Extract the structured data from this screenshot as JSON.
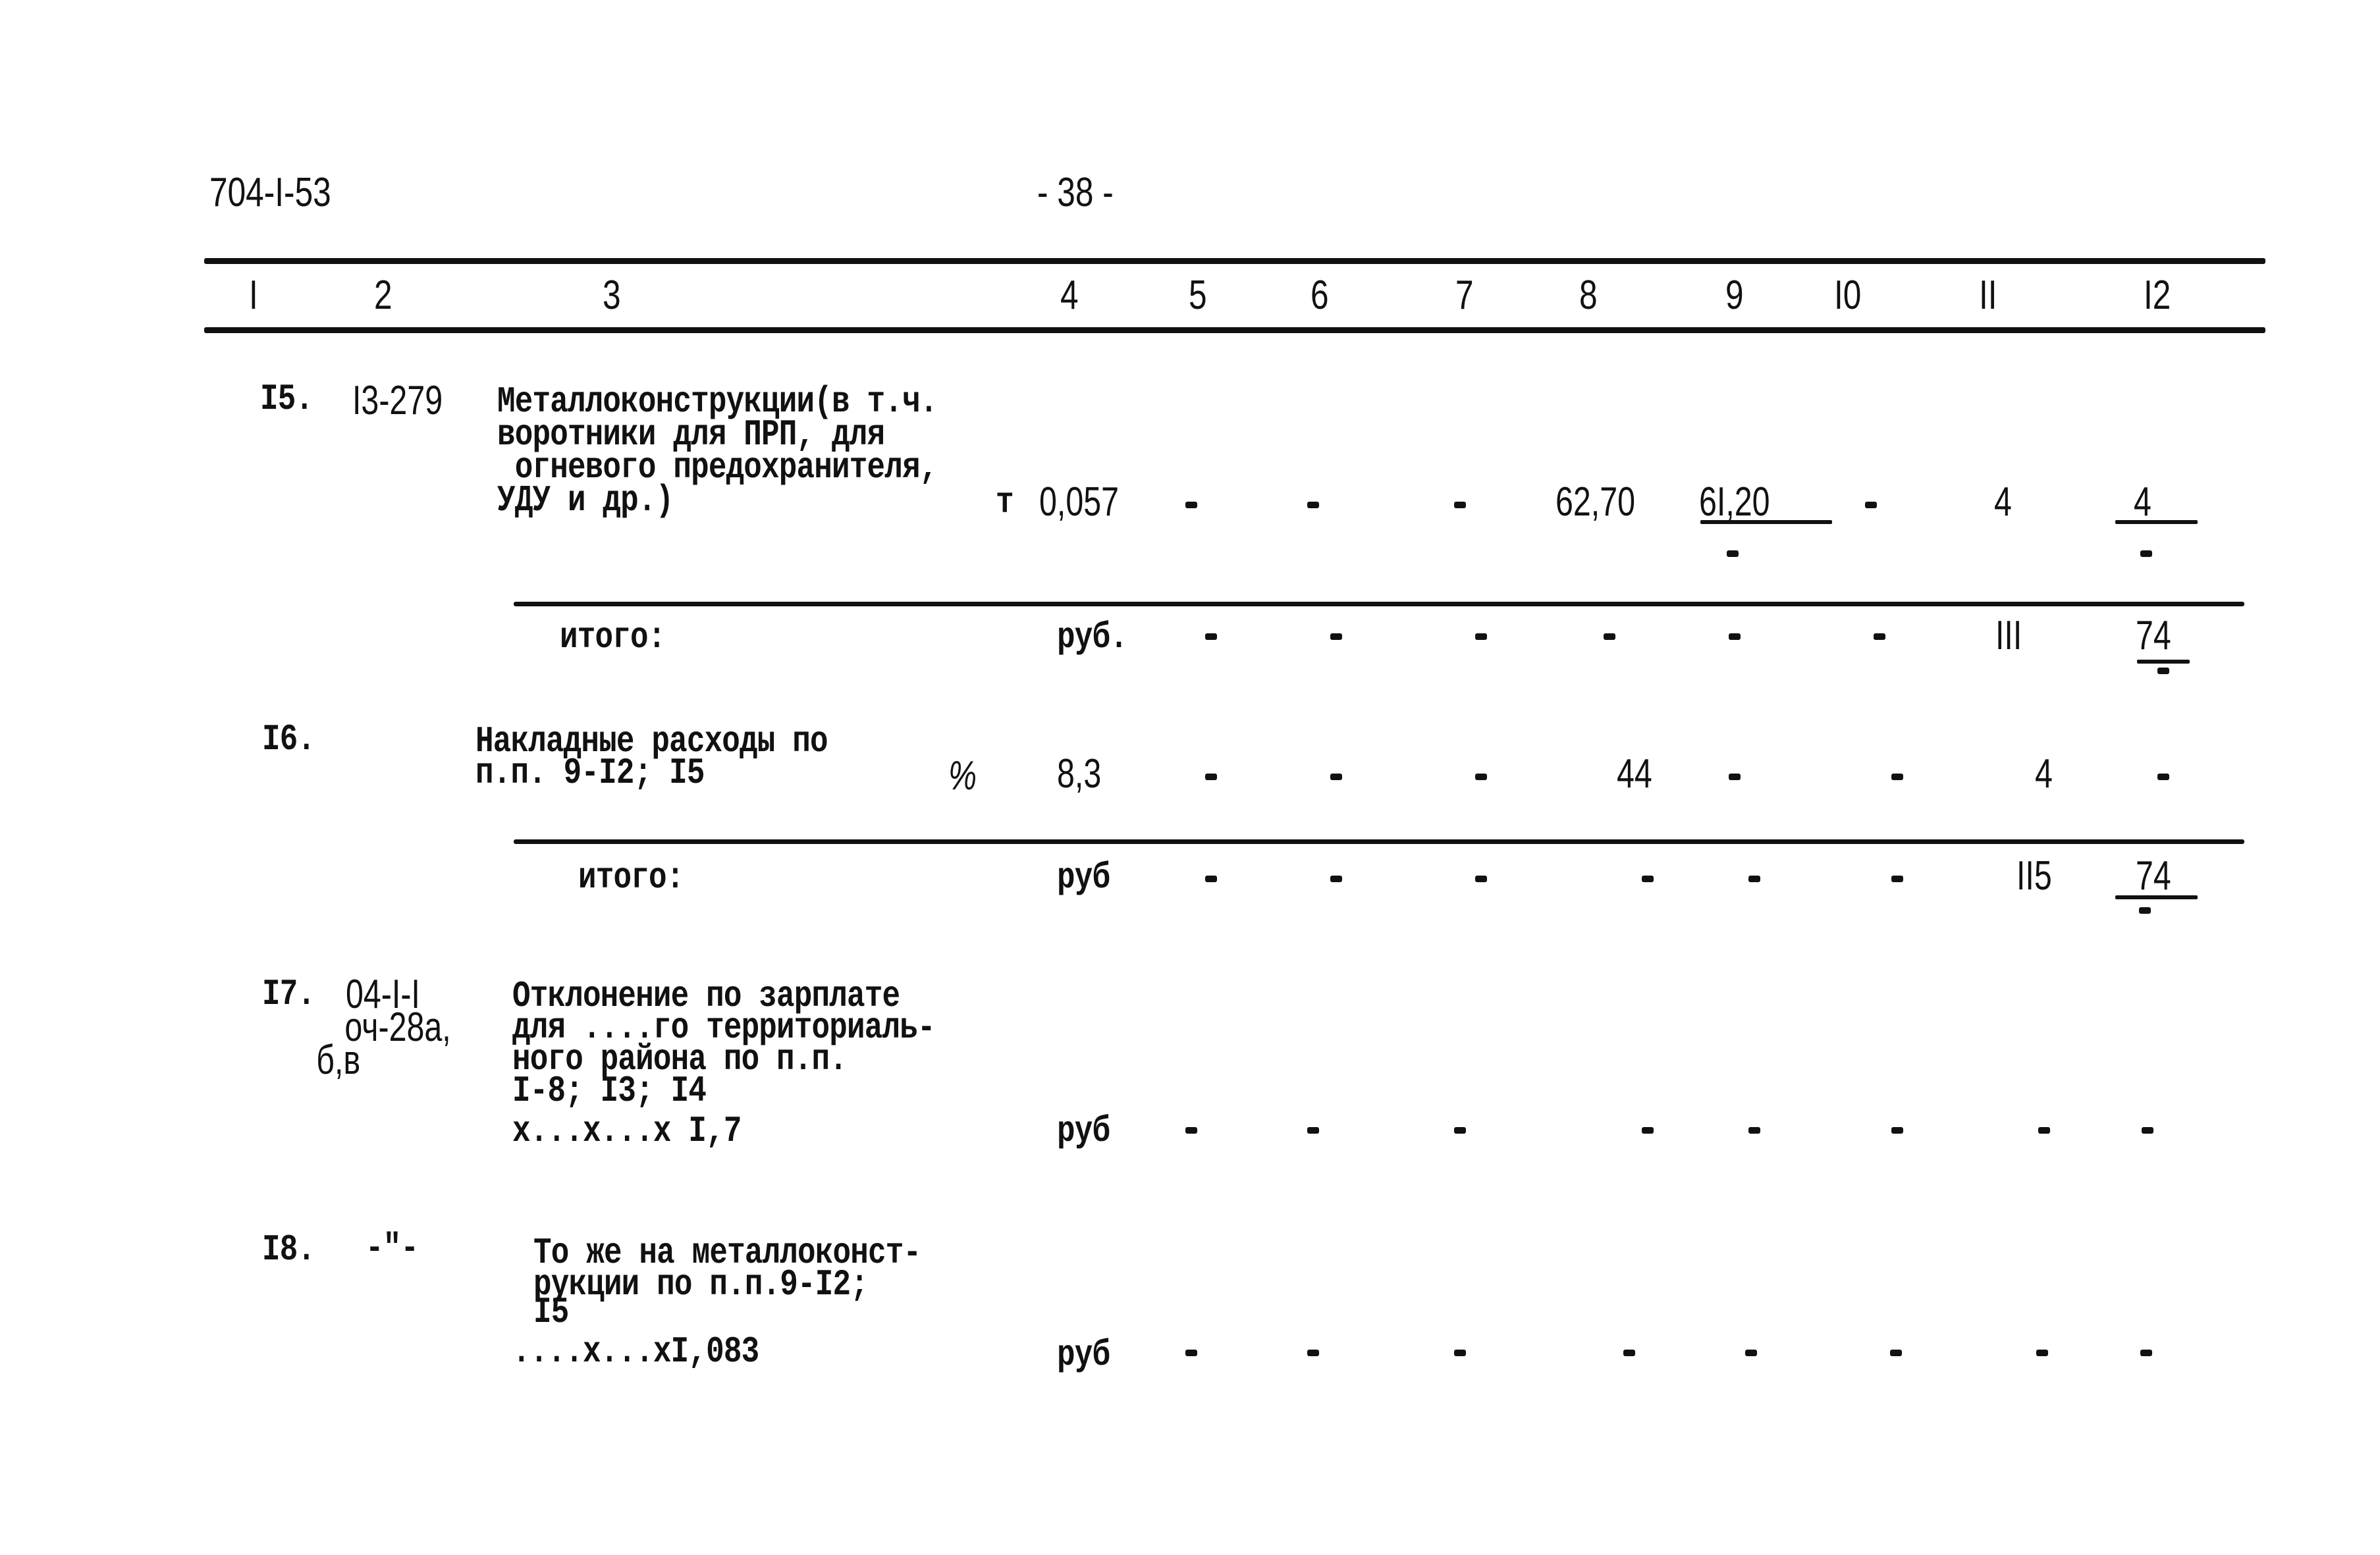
{
  "header": {
    "doc_code": "704-I-53",
    "page_number": "- 38 -"
  },
  "table": {
    "column_headers": [
      "I",
      "2",
      "3",
      "4",
      "5",
      "6",
      "7",
      "8",
      "9",
      "I0",
      "II",
      "I2"
    ],
    "rows": [
      {
        "number": "I5.",
        "code_lines": [
          "I3-279"
        ],
        "description_lines": [
          "Металлоконструкции(в т.ч.",
          "воротники для ПРП, для",
          " огневого предохранителя,",
          "УДУ и др.)"
        ],
        "unit": "т",
        "cells": {
          "c4": "0,057",
          "c5": "-",
          "c6": "-",
          "c7": "-",
          "c8": "62,70",
          "c9": "6I,20",
          "c10": "-",
          "c11": "4",
          "c12": "4"
        },
        "sub_cells": {
          "c9": "-",
          "c12": "-"
        },
        "underlined": [
          "c9",
          "c12"
        ]
      },
      {
        "type": "total",
        "label": "итого:",
        "unit": "руб.",
        "cells": {
          "c5": "-",
          "c6": "-",
          "c7": "-",
          "c8": "-",
          "c9": "-",
          "c10": "-",
          "c11": "III",
          "c12": "74"
        },
        "sub_cells": {
          "c12": "-"
        },
        "underlined": [
          "c12"
        ]
      },
      {
        "number": "I6.",
        "code_lines": [],
        "description_lines": [
          "Накладные расходы по",
          "п.п. 9-I2; I5"
        ],
        "unit": "%",
        "cells": {
          "c4": "8,3",
          "c5": "-",
          "c6": "-",
          "c7": "-",
          "c8": "44",
          "c9": "-",
          "c10": "-",
          "c11": "4",
          "c12": "-"
        }
      },
      {
        "type": "total",
        "label": "итого:",
        "unit": "руб",
        "cells": {
          "c5": "-",
          "c6": "-",
          "c7": "-",
          "c8": "-",
          "c9": "-",
          "c10": "-",
          "c11": "II5",
          "c12": "74"
        },
        "sub_cells": {
          "c12": "-"
        },
        "underlined": [
          "c12"
        ]
      },
      {
        "number": "I7.",
        "code_lines": [
          "04-I-I",
          " оч-28а,",
          "   б,в"
        ],
        "description_lines": [
          "Отклонение по зарплате",
          "для ....го территориаль-",
          "ного района по п.п.",
          "I-8; I3; I4",
          "х...х...х I,7"
        ],
        "unit": "руб",
        "cells": {
          "c5": "-",
          "c6": "-",
          "c7": "-",
          "c8": "-",
          "c9": "-",
          "c10": "-",
          "c11": "-",
          "c12": "-"
        }
      },
      {
        "number": "I8.",
        "code_lines": [
          "-\"-"
        ],
        "description_lines": [
          "То же на металлоконст-",
          "рукции по п.п.9-I2;",
          "I5",
          "....х...хI,083"
        ],
        "unit": "руб",
        "cells": {
          "c5": "-",
          "c6": "-",
          "c7": "-",
          "c8": "-",
          "c9": "-",
          "c10": "-",
          "c11": "-",
          "c12": "-"
        }
      }
    ]
  }
}
